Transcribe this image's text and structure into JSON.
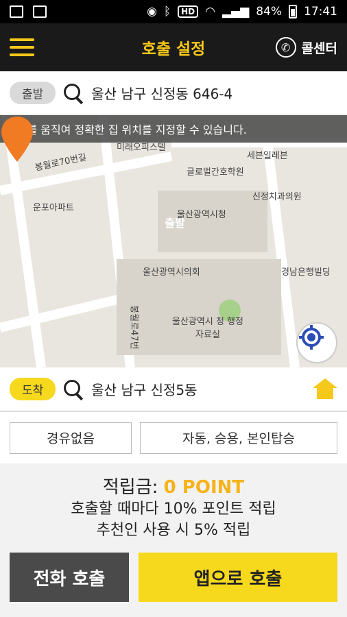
{
  "status": {
    "battery": "84%",
    "time": "17:41",
    "hd": "HD"
  },
  "header": {
    "title": "호출 설정",
    "call_center": "콜센터"
  },
  "departure": {
    "badge": "출발",
    "address": "울산 남구 신정동 646-4"
  },
  "map": {
    "banner": "지도를 움직여 정확한 집 위치를 지정할 수 있습니다.",
    "pin_label": "출발",
    "labels": [
      "봉월로70번길",
      "미래오피스텔",
      "세븐일레븐",
      "글로벌간호학원",
      "운포아파트",
      "신정치과의원",
      "울산광역시청",
      "울산광역시의회",
      "경남은행빌딩",
      "울산광역시 청 행정자료실",
      "봉월로47번"
    ]
  },
  "arrival": {
    "badge": "도착",
    "address": "울산 남구 신정5동"
  },
  "options": {
    "waypoint": "경유없음",
    "vehicle": "자동, 승용, 본인탑승"
  },
  "points": {
    "label": "적립금:",
    "value": "0 POINT",
    "line2": "호출할 때마다 10% 포인트 적립",
    "line3": "추천인 사용 시 5% 적립"
  },
  "buttons": {
    "phone_call": "전화 호출",
    "app_call": "앱으로 호출"
  },
  "colors": {
    "accent": "#f6c819",
    "dark": "#1a1a1a",
    "pin": "#f07b22"
  }
}
